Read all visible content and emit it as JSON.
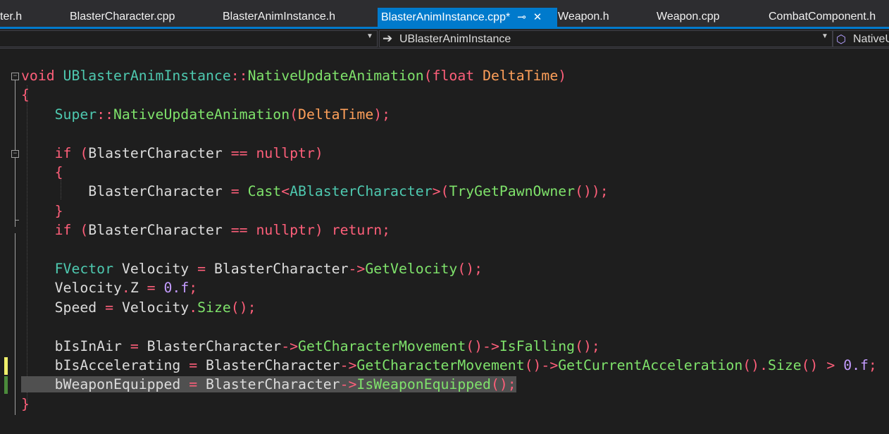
{
  "tabs": [
    {
      "label": "ter.h"
    },
    {
      "label": "BlasterCharacter.cpp"
    },
    {
      "label": "BlasterAnimInstance.h"
    },
    {
      "label": "BlasterAnimInstance.cpp*",
      "active": true
    },
    {
      "label": "Weapon.h"
    },
    {
      "label": "Weapon.cpp"
    },
    {
      "label": "CombatComponent.h"
    }
  ],
  "icons": {
    "pin": "pin-icon",
    "close": "close-icon",
    "arrow": "arrow-right-icon",
    "member": "member-icon"
  },
  "navbar": {
    "scope_text": "UBlasterAnimInstance",
    "member_text": "NativeU"
  },
  "colors": {
    "accent": "#007acc",
    "keyword": "#569cd6",
    "function": "#7fe36b",
    "type": "#4ec9b0",
    "variable": "#dcdcdc",
    "parameter": "#ffa05a",
    "operator": "#ff5f7a",
    "number": "#c49cff",
    "change_saved": "#4b8b3b",
    "change_unsaved": "#f0f06b"
  },
  "code_lines": [
    [
      {
        "t": "void ",
        "c": "op"
      },
      {
        "t": "UBlasterAnimInstance",
        "c": "type"
      },
      {
        "t": "::",
        "c": "op"
      },
      {
        "t": "NativeUpdateAnimation",
        "c": "fn"
      },
      {
        "t": "(",
        "c": "op"
      },
      {
        "t": "float ",
        "c": "op"
      },
      {
        "t": "DeltaTime",
        "c": "param"
      },
      {
        "t": ")",
        "c": "op"
      }
    ],
    [
      {
        "t": "{",
        "c": "op"
      }
    ],
    [
      {
        "t": "    "
      },
      {
        "t": "Super",
        "c": "type"
      },
      {
        "t": "::",
        "c": "op"
      },
      {
        "t": "NativeUpdateAnimation",
        "c": "fn"
      },
      {
        "t": "(",
        "c": "op"
      },
      {
        "t": "DeltaTime",
        "c": "param"
      },
      {
        "t": ");",
        "c": "op"
      }
    ],
    [],
    [
      {
        "t": "    "
      },
      {
        "t": "if ",
        "c": "op"
      },
      {
        "t": "(",
        "c": "op"
      },
      {
        "t": "BlasterCharacter ",
        "c": "var"
      },
      {
        "t": "== ",
        "c": "op"
      },
      {
        "t": "nullptr",
        "c": "op"
      },
      {
        "t": ")",
        "c": "op"
      }
    ],
    [
      {
        "t": "    "
      },
      {
        "t": "{",
        "c": "op"
      }
    ],
    [
      {
        "t": "        "
      },
      {
        "t": "BlasterCharacter ",
        "c": "var"
      },
      {
        "t": "= ",
        "c": "op"
      },
      {
        "t": "Cast",
        "c": "fn"
      },
      {
        "t": "<",
        "c": "op"
      },
      {
        "t": "ABlasterCharacter",
        "c": "type"
      },
      {
        "t": ">(",
        "c": "op"
      },
      {
        "t": "TryGetPawnOwner",
        "c": "fn"
      },
      {
        "t": "());",
        "c": "op"
      }
    ],
    [
      {
        "t": "    "
      },
      {
        "t": "}",
        "c": "op"
      }
    ],
    [
      {
        "t": "    "
      },
      {
        "t": "if ",
        "c": "op"
      },
      {
        "t": "(",
        "c": "op"
      },
      {
        "t": "BlasterCharacter ",
        "c": "var"
      },
      {
        "t": "== ",
        "c": "op"
      },
      {
        "t": "nullptr",
        "c": "op"
      },
      {
        "t": ") ",
        "c": "op"
      },
      {
        "t": "return",
        "c": "op"
      },
      {
        "t": ";",
        "c": "op"
      }
    ],
    [],
    [
      {
        "t": "    "
      },
      {
        "t": "FVector ",
        "c": "type"
      },
      {
        "t": "Velocity ",
        "c": "var"
      },
      {
        "t": "= ",
        "c": "op"
      },
      {
        "t": "BlasterCharacter",
        "c": "var"
      },
      {
        "t": "->",
        "c": "op"
      },
      {
        "t": "GetVelocity",
        "c": "fn"
      },
      {
        "t": "();",
        "c": "op"
      }
    ],
    [
      {
        "t": "    "
      },
      {
        "t": "Velocity",
        "c": "var"
      },
      {
        "t": ".",
        "c": "op"
      },
      {
        "t": "Z ",
        "c": "var"
      },
      {
        "t": "= ",
        "c": "op"
      },
      {
        "t": "0.f",
        "c": "num"
      },
      {
        "t": ";",
        "c": "op"
      }
    ],
    [
      {
        "t": "    "
      },
      {
        "t": "Speed ",
        "c": "var"
      },
      {
        "t": "= ",
        "c": "op"
      },
      {
        "t": "Velocity",
        "c": "var"
      },
      {
        "t": ".",
        "c": "op"
      },
      {
        "t": "Size",
        "c": "fn"
      },
      {
        "t": "();",
        "c": "op"
      }
    ],
    [],
    [
      {
        "t": "    "
      },
      {
        "t": "bIsInAir ",
        "c": "var"
      },
      {
        "t": "= ",
        "c": "op"
      },
      {
        "t": "BlasterCharacter",
        "c": "var"
      },
      {
        "t": "->",
        "c": "op"
      },
      {
        "t": "GetCharacterMovement",
        "c": "fn"
      },
      {
        "t": "()->",
        "c": "op"
      },
      {
        "t": "IsFalling",
        "c": "fn"
      },
      {
        "t": "();",
        "c": "op"
      }
    ],
    [
      {
        "t": "    "
      },
      {
        "t": "bIsAccelerating ",
        "c": "var"
      },
      {
        "t": "= ",
        "c": "op"
      },
      {
        "t": "BlasterCharacter",
        "c": "var"
      },
      {
        "t": "->",
        "c": "op"
      },
      {
        "t": "GetCharacterMovement",
        "c": "fn"
      },
      {
        "t": "()->",
        "c": "op"
      },
      {
        "t": "GetCurrentAcceleration",
        "c": "fn"
      },
      {
        "t": "().",
        "c": "op"
      },
      {
        "t": "Size",
        "c": "fn"
      },
      {
        "t": "() > ",
        "c": "op"
      },
      {
        "t": "0.f",
        "c": "num"
      },
      {
        "t": ";",
        "c": "op"
      }
    ],
    [
      {
        "t": "    "
      },
      {
        "t": "bWeaponEquipped ",
        "c": "var",
        "hl": true
      },
      {
        "t": "= ",
        "c": "op",
        "hl": true
      },
      {
        "t": "BlasterCharacter",
        "c": "var",
        "hl": true
      },
      {
        "t": "->",
        "c": "op",
        "hl": true
      },
      {
        "t": "IsWeaponEquipped",
        "c": "fn",
        "hl": true
      },
      {
        "t": "();",
        "c": "op",
        "hl": true
      }
    ],
    [
      {
        "t": "}",
        "c": "op"
      }
    ]
  ]
}
